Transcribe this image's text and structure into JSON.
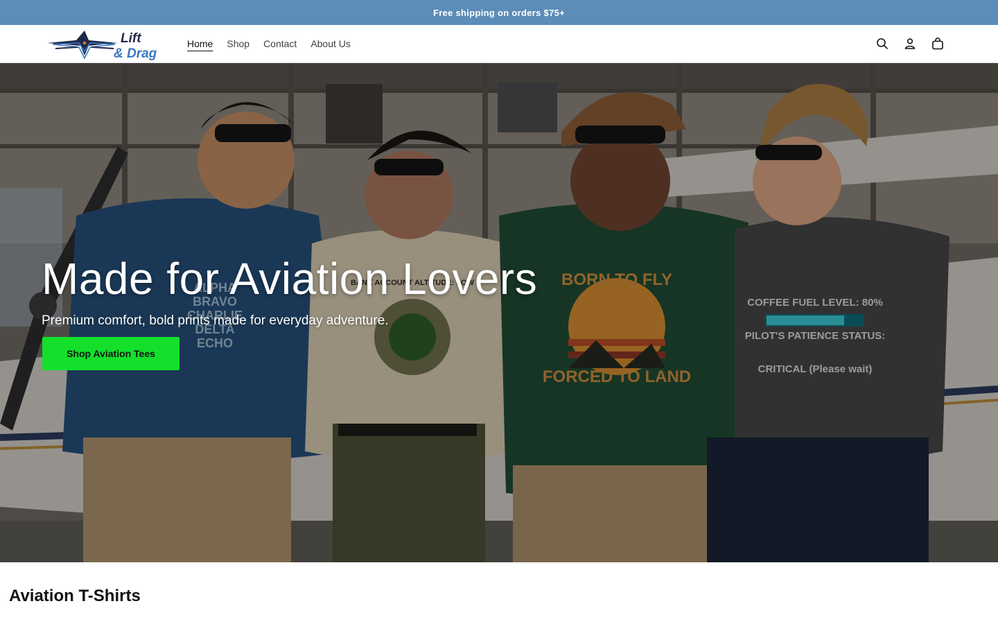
{
  "announcement": {
    "text": "Free shipping on orders $75+"
  },
  "brand": {
    "name_line1": "Lift",
    "name_line2": "& Drag",
    "colors": {
      "navy": "#1e2a4a",
      "blue": "#3a78c2",
      "orange": "#e07a2a"
    }
  },
  "nav": {
    "items": [
      {
        "label": "Home",
        "active": true
      },
      {
        "label": "Shop",
        "active": false
      },
      {
        "label": "Contact",
        "active": false
      },
      {
        "label": "About Us",
        "active": false
      }
    ]
  },
  "header_icons": {
    "search": "search-icon",
    "account": "account-icon",
    "cart": "cart-icon"
  },
  "hero": {
    "title": "Made for Aviation Lovers",
    "subtitle": "Premium comfort, bold prints made for everyday adventure.",
    "cta_label": "Shop Aviation Tees",
    "cta_color": "#14e02c",
    "shirts": [
      {
        "lines": [
          "ALPHA",
          "BRAVO",
          "CHARLIE",
          "DELTA",
          "ECHO"
        ]
      },
      {
        "lines": [
          "BANK ACCOUNT ALTITUDE: LOW"
        ]
      },
      {
        "lines": [
          "BORN TO FLY",
          "FORCED TO LAND"
        ]
      },
      {
        "lines": [
          "COFFEE FUEL LEVEL: 80%",
          "PILOT'S PATIENCE STATUS:",
          "CRITICAL (Please wait)"
        ]
      }
    ]
  },
  "section": {
    "title": "Aviation T-Shirts"
  },
  "colors": {
    "announcement_bg": "#5b8db8",
    "text": "#121212"
  }
}
